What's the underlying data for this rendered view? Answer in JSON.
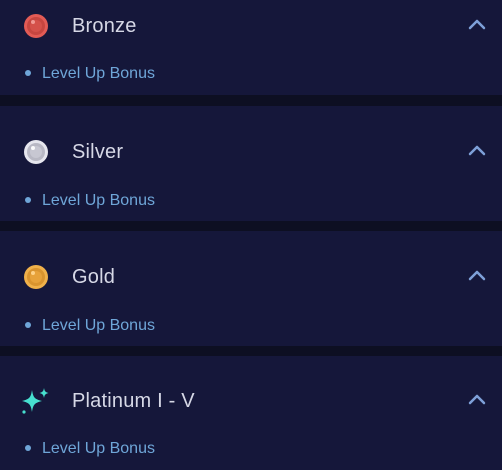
{
  "tiers": [
    {
      "name": "Bronze",
      "bonus": "Level Up Bonus",
      "icon": "bronze-coin-icon",
      "color": "#d9534f"
    },
    {
      "name": "Silver",
      "bonus": "Level Up Bonus",
      "icon": "silver-coin-icon",
      "color": "#c9c9d1"
    },
    {
      "name": "Gold",
      "bonus": "Level Up Bonus",
      "icon": "gold-coin-icon",
      "color": "#e7a64a"
    },
    {
      "name": "Platinum I - V",
      "bonus": "Level Up Bonus",
      "icon": "sparkle-icon",
      "color": "#49e0d0"
    }
  ],
  "colors": {
    "background": "#0d0f22",
    "card": "#15173a",
    "title_text": "#d6d8e6",
    "bonus_text": "#6fa6d8",
    "chevron": "#7ea0d8"
  }
}
